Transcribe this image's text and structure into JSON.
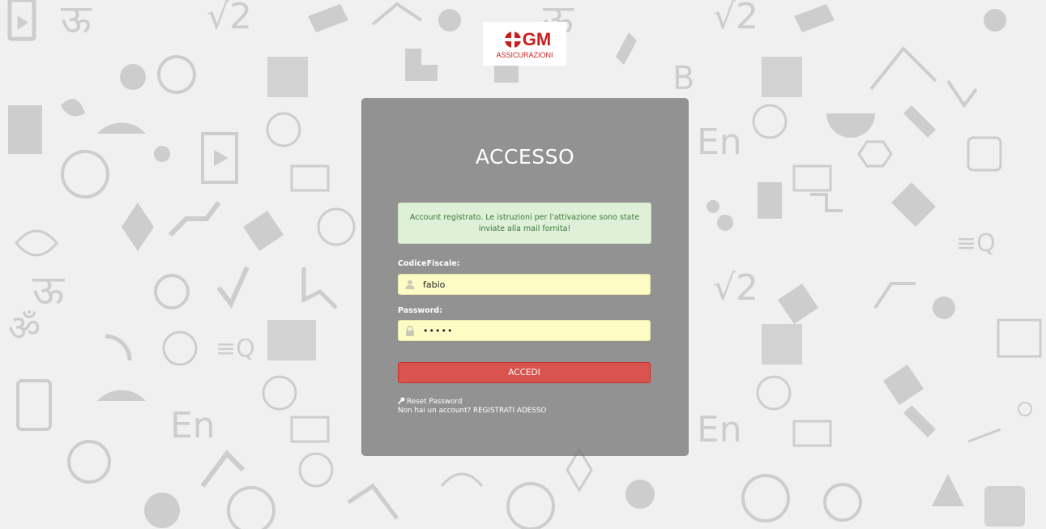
{
  "brand": {
    "logo_text": "GM",
    "logo_subtext": "ASSICURAZIONI",
    "accent_color": "#c8201f"
  },
  "login": {
    "title": "ACCESSO",
    "alert_message": "Account registrato. Le istruzioni per l'attivazione sono state inviate alla mail fornita!",
    "codice_fiscale_label": "CodiceFiscale:",
    "codice_fiscale_value": "fabio",
    "password_label": "Password:",
    "password_value": "•••••",
    "submit_label": "ACCEDI",
    "reset_password_label": "Reset Password",
    "register_label": "Non hai un account? REGISTRATI ADESSO",
    "submit_color": "#d9534f",
    "alert_color": "#dff0d8"
  },
  "icons": {
    "user": "user-icon",
    "lock": "lock-icon",
    "key": "key-icon"
  }
}
